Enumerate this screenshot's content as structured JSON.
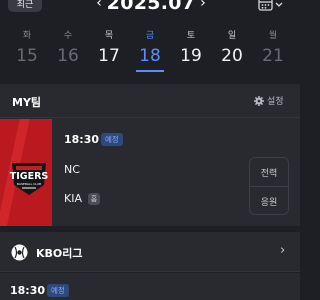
{
  "header": {
    "recent_label": "최근",
    "month_title": "2025.07",
    "prev_icon": "chevron-left-icon",
    "next_icon": "chevron-right-icon",
    "calendar_icon": "calendar-dropdown-icon"
  },
  "week": [
    {
      "dow": "화",
      "num": "15"
    },
    {
      "dow": "수",
      "num": "16"
    },
    {
      "dow": "목",
      "num": "17"
    },
    {
      "dow": "금",
      "num": "18",
      "selected": true
    },
    {
      "dow": "토",
      "num": "19"
    },
    {
      "dow": "일",
      "num": "20"
    },
    {
      "dow": "월",
      "num": "21"
    }
  ],
  "myteam": {
    "title": "MY팀",
    "settings_label": "설정",
    "logo_name": "TIGERS",
    "logo_sub": "BASEBALL CLUB",
    "game": {
      "time": "18:30",
      "status": "예정",
      "away_team": "NC",
      "home_team": "KIA",
      "home_badge": "홈"
    },
    "actions": {
      "record_label": "전력",
      "cheer_label": "응원"
    }
  },
  "league": {
    "title": "KBO리그",
    "next_game": {
      "time": "18:30",
      "status": "예정"
    }
  },
  "colors": {
    "background": "#1e1f24",
    "card": "#292a30",
    "accent": "#5c8dff",
    "tigers_red": "#b9191f"
  }
}
